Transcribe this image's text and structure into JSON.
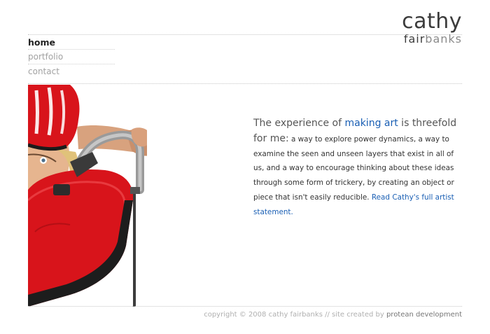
{
  "logo": {
    "first": "cathy",
    "last_accent": "fair",
    "last_rest": "banks"
  },
  "nav": [
    {
      "label": "home",
      "active": true
    },
    {
      "label": "portfolio",
      "active": false
    },
    {
      "label": "contact",
      "active": false
    }
  ],
  "statement": {
    "lead_1": "The experience of ",
    "lead_highlight": "making art",
    "lead_2": " is threefold for me:",
    "body": " a way to explore power dynamics, a way to examine the seen and unseen layers that exist in all of us, and a way to encourage thinking about these ideas through some form of trickery, by creating an object or piece that isn't easily reducible. ",
    "link": "Read Cathy's full artist statement."
  },
  "footer": {
    "copyright": "copyright © 2008 cathy fairbanks // site created by ",
    "credit_link": "protean development"
  },
  "colors": {
    "accent_blue": "#1a5fb4",
    "helmet_red": "#d8141b",
    "text_dark": "#333333",
    "muted_gray": "#a2a2a2"
  }
}
